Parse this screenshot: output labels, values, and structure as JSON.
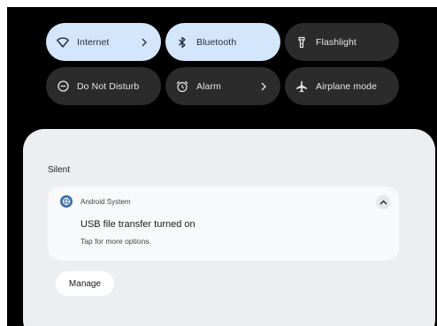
{
  "quick_settings": {
    "tiles": [
      {
        "label": "Internet",
        "icon": "wifi-icon",
        "state": "on",
        "has_chevron": true
      },
      {
        "label": "Bluetooth",
        "icon": "bluetooth-icon",
        "state": "on",
        "has_chevron": false
      },
      {
        "label": "Flashlight",
        "icon": "flashlight-icon",
        "state": "off",
        "has_chevron": false
      },
      {
        "label": "Do Not Disturb",
        "icon": "do-not-disturb-icon",
        "state": "off",
        "has_chevron": false
      },
      {
        "label": "Alarm",
        "icon": "alarm-icon",
        "state": "off",
        "has_chevron": true
      },
      {
        "label": "Airplane mode",
        "icon": "airplane-icon",
        "state": "off",
        "has_chevron": false
      }
    ],
    "chevron_glyph": ">"
  },
  "notifications": {
    "section_title": "Silent",
    "items": [
      {
        "app_name": "Android System",
        "title": "USB file transfer turned on",
        "text": "Tap for more options.",
        "icon": "android-system-icon"
      }
    ],
    "manage_label": "Manage"
  },
  "colors": {
    "background": "#000000",
    "tile_active": "#d4e6fb",
    "tile_inactive": "#2b2b2b",
    "shade": "#eceef1",
    "card": "#f8f9fa"
  }
}
